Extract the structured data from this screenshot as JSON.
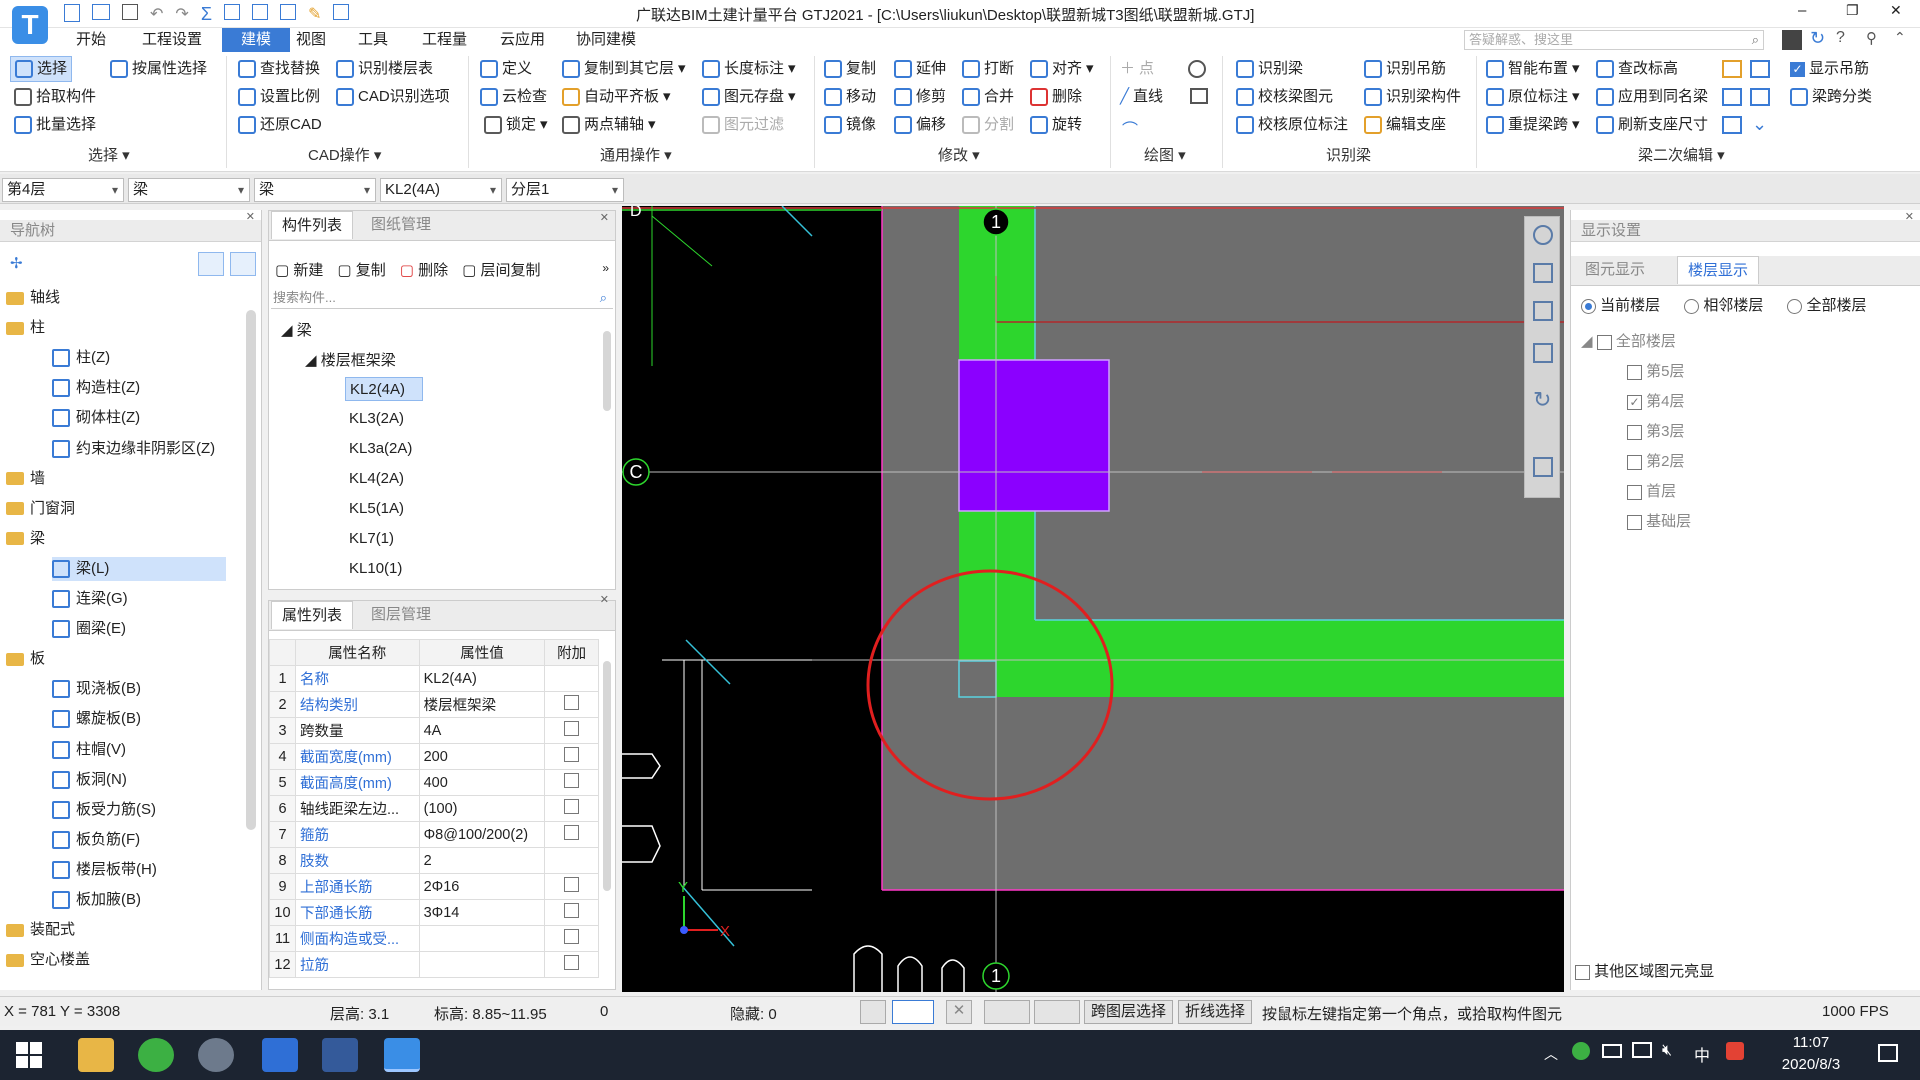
{
  "titlebar": {
    "title": "广联达BIM土建计量平台 GTJ2021 - [C:\\Users\\liukun\\Desktop\\联盟新城T3图纸\\联盟新城.GTJ]",
    "search_placeholder": "答疑解惑、搜这里",
    "logo_letter": "T",
    "help_glyph": "?",
    "minimize": "–",
    "restore": "❐",
    "close": "✕"
  },
  "menu": [
    "开始",
    "工程设置",
    "建模",
    "视图",
    "工具",
    "工程量",
    "云应用",
    "协同建模"
  ],
  "ribbon": {
    "select": {
      "items": [
        "选择",
        "按属性选择",
        "拾取构件",
        "批量选择"
      ],
      "label": "选择"
    },
    "cad": {
      "items": [
        "查找替换",
        "识别楼层表",
        "设置比例",
        "CAD识别选项",
        "还原CAD"
      ],
      "label": "CAD操作"
    },
    "common": {
      "items": [
        "定义",
        "复制到其它层",
        "长度标注",
        "云检查",
        "自动平齐板",
        "图元存盘",
        "锁定",
        "两点辅轴",
        "图元过滤"
      ],
      "label": "通用操作"
    },
    "modify": {
      "items": [
        "复制",
        "延伸",
        "打断",
        "对齐",
        "移动",
        "修剪",
        "合并",
        "删除",
        "镜像",
        "偏移",
        "分割",
        "旋转"
      ],
      "label": "修改"
    },
    "draw": {
      "items": [
        "点",
        "直线"
      ],
      "label": "绘图"
    },
    "identify": {
      "items": [
        "识别梁",
        "识别吊筋",
        "校核梁图元",
        "识别梁构件",
        "校核原位标注",
        "编辑支座"
      ],
      "label": "识别梁"
    },
    "beam2": {
      "items": [
        "智能布置",
        "查改标高",
        "显示吊筋",
        "原位标注",
        "应用到同名梁",
        "梁跨分类",
        "重提梁跨",
        "刷新支座尺寸"
      ],
      "label": "梁二次编辑"
    }
  },
  "selectors": [
    "第4层",
    "梁",
    "梁",
    "KL2(4A)",
    "分层1"
  ],
  "nav": {
    "title": "导航树",
    "items": [
      {
        "label": "轴线",
        "type": "folder"
      },
      {
        "label": "柱",
        "type": "folder"
      },
      {
        "label": "柱(Z)",
        "type": "child"
      },
      {
        "label": "构造柱(Z)",
        "type": "child"
      },
      {
        "label": "砌体柱(Z)",
        "type": "child"
      },
      {
        "label": "约束边缘非阴影区(Z)",
        "type": "child"
      },
      {
        "label": "墙",
        "type": "folder"
      },
      {
        "label": "门窗洞",
        "type": "folder"
      },
      {
        "label": "梁",
        "type": "folder"
      },
      {
        "label": "梁(L)",
        "type": "child",
        "selected": true
      },
      {
        "label": "连梁(G)",
        "type": "child"
      },
      {
        "label": "圈梁(E)",
        "type": "child"
      },
      {
        "label": "板",
        "type": "folder"
      },
      {
        "label": "现浇板(B)",
        "type": "child"
      },
      {
        "label": "螺旋板(B)",
        "type": "child"
      },
      {
        "label": "柱帽(V)",
        "type": "child"
      },
      {
        "label": "板洞(N)",
        "type": "child"
      },
      {
        "label": "板受力筋(S)",
        "type": "child"
      },
      {
        "label": "板负筋(F)",
        "type": "child"
      },
      {
        "label": "楼层板带(H)",
        "type": "child"
      },
      {
        "label": "板加腋(B)",
        "type": "child"
      },
      {
        "label": "装配式",
        "type": "folder"
      },
      {
        "label": "空心楼盖",
        "type": "folder"
      }
    ]
  },
  "components": {
    "tabs": [
      "构件列表",
      "图纸管理"
    ],
    "toolbar": [
      "新建",
      "复制",
      "删除",
      "层间复制"
    ],
    "search_placeholder": "搜索构件...",
    "root": "梁",
    "group": "楼层框架梁",
    "items": [
      "KL2(4A)",
      "KL3(2A)",
      "KL3a(2A)",
      "KL4(2A)",
      "KL5(1A)",
      "KL7(1)",
      "KL10(1)"
    ]
  },
  "properties": {
    "tabs": [
      "属性列表",
      "图层管理"
    ],
    "headers": [
      "属性名称",
      "属性值",
      "附加"
    ],
    "rows": [
      {
        "n": "1",
        "name": "名称",
        "value": "KL2(4A)",
        "blue": true,
        "chk": false
      },
      {
        "n": "2",
        "name": "结构类别",
        "value": "楼层框架梁",
        "blue": true,
        "chk": true
      },
      {
        "n": "3",
        "name": "跨数量",
        "value": "4A",
        "blue": false,
        "chk": true
      },
      {
        "n": "4",
        "name": "截面宽度(mm)",
        "value": "200",
        "blue": true,
        "chk": true
      },
      {
        "n": "5",
        "name": "截面高度(mm)",
        "value": "400",
        "blue": true,
        "chk": true
      },
      {
        "n": "6",
        "name": "轴线距梁左边...",
        "value": "(100)",
        "blue": false,
        "chk": true
      },
      {
        "n": "7",
        "name": "箍筋",
        "value": "Φ8@100/200(2)",
        "blue": true,
        "chk": true
      },
      {
        "n": "8",
        "name": "肢数",
        "value": "2",
        "blue": true,
        "chk": false
      },
      {
        "n": "9",
        "name": "上部通长筋",
        "value": "2Φ16",
        "blue": true,
        "chk": true
      },
      {
        "n": "10",
        "name": "下部通长筋",
        "value": "3Φ14",
        "blue": true,
        "chk": true
      },
      {
        "n": "11",
        "name": "侧面构造或受...",
        "value": "",
        "blue": true,
        "chk": true
      },
      {
        "n": "12",
        "name": "拉筋",
        "value": "",
        "blue": true,
        "chk": true
      }
    ]
  },
  "canvas": {
    "axis_labels": [
      "D",
      "1",
      "C",
      "1"
    ],
    "x_label": "X",
    "y_label": "Y",
    "colors": {
      "beam": "#2dd62d",
      "column": "#8b00ff",
      "slab": "#6e6e6e",
      "highlight": "#e01f1f"
    }
  },
  "display": {
    "title": "显示设置",
    "tabs": [
      "图元显示",
      "楼层显示"
    ],
    "radios": [
      "当前楼层",
      "相邻楼层",
      "全部楼层"
    ],
    "root": "全部楼层",
    "floors": [
      {
        "label": "第5层",
        "checked": false
      },
      {
        "label": "第4层",
        "checked": true
      },
      {
        "label": "第3层",
        "checked": false
      },
      {
        "label": "第2层",
        "checked": false
      },
      {
        "label": "首层",
        "checked": false
      },
      {
        "label": "基础层",
        "checked": false
      }
    ],
    "footer": "其他区域图元亮显"
  },
  "status": {
    "coords": "X = 781 Y = 3308",
    "floor_height": "层高:  3.1",
    "elevation": "标高:  8.85~11.95",
    "zero": "0",
    "hidden": "隐藏:  0",
    "cross_floor": "跨图层选择",
    "polyline": "折线选择",
    "hint": "按鼠标左键指定第一个角点，或拾取构件图元",
    "fps": "1000 FPS"
  },
  "taskbar": {
    "time": "11:07",
    "date": "2020/8/3",
    "ime": "中"
  }
}
